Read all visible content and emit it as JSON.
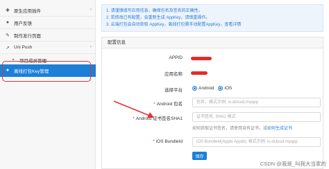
{
  "sidebar": {
    "items": [
      {
        "label": "原生应用插件",
        "icon": "puzzle-icon"
      },
      {
        "label": "用户反馈",
        "icon": "user-icon"
      },
      {
        "label": "制作发行页面",
        "icon": "edit-icon"
      },
      {
        "label": "Uni Push",
        "icon": "rocket-icon"
      },
      {
        "label": "项目成员管理",
        "icon": "member-icon"
      },
      {
        "label": "离线打包Key管理",
        "icon": "key-icon"
      }
    ]
  },
  "notice": {
    "line1": "1. 请谨慎填写应用信息，确保包名及签名的正确性。",
    "line2": "2. 若修改已有配置，会重新生成 AppKey，请慎重操作。",
    "line3_prefix": "3. 云端打包会自动获取 AppKey，离线打包需手动配置AppKey，",
    "line3_link": "查看详情"
  },
  "panel": {
    "title": "配置信息",
    "appid_label": "APPID",
    "appname_label": "应用名称",
    "platform_label": "选择平台",
    "platform_options": [
      "Android",
      "iOS"
    ],
    "android_pkg_label": "Android 包名",
    "android_pkg_placeholder": "包名，格式示例: io.dcloud.myapp",
    "android_sha1_label": "Android 证书签名SHA1",
    "android_sha1_placeholder": "证书签名, SHA1 格式",
    "android_sha1_help_prefix": "如何获取证书签名，请使用自有证书，或",
    "android_sha1_help_link": "如何生成证书",
    "ios_bundle_label": "iOS BundleId",
    "ios_bundle_placeholder": "iOS BundleId(Apple Appid), 格式示例: io.dcloud.myapp",
    "save_label": "保存"
  },
  "watermark": "CSDN @我是_叫我大当家的",
  "colors": {
    "accent": "#1c7fd8",
    "annotation": "#e53030"
  }
}
